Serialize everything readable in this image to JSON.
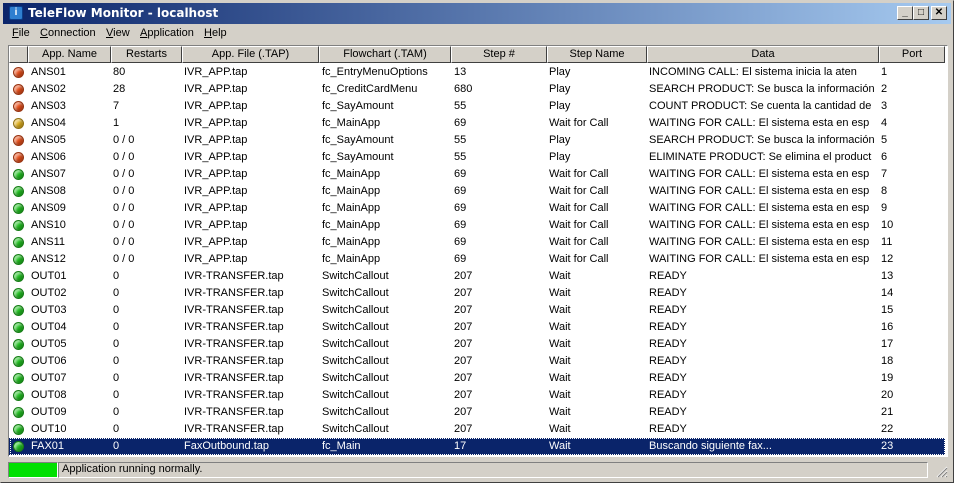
{
  "window": {
    "title": "TeleFlow Monitor - localhost",
    "icon": "info-app-icon",
    "controls": {
      "minimize": "_",
      "maximize": "□",
      "close": "✕"
    }
  },
  "menu": [
    {
      "label": "File",
      "accel": "F",
      "rest": "ile"
    },
    {
      "label": "Connection",
      "accel": "C",
      "rest": "onnection"
    },
    {
      "label": "View",
      "accel": "V",
      "rest": "iew"
    },
    {
      "label": "Application",
      "accel": "A",
      "rest": "pplication"
    },
    {
      "label": "Help",
      "accel": "H",
      "rest": "elp"
    }
  ],
  "columns": [
    "App. Name",
    "Restarts",
    "App. File (.TAP)",
    "Flowchart (.TAM)",
    "Step #",
    "Step Name",
    "Data",
    "Port"
  ],
  "status_colors": {
    "red": "#e8501c",
    "yellow": "#e0b020",
    "green": "#22c022"
  },
  "rows": [
    {
      "status": "red",
      "name": "ANS01",
      "restarts": "80",
      "file": "IVR_APP.tap",
      "flow": "fc_EntryMenuOptions",
      "step": "13",
      "stepName": "Play",
      "data": "INCOMING CALL: El sistema inicia la aten",
      "port": "1"
    },
    {
      "status": "red",
      "name": "ANS02",
      "restarts": "28",
      "file": "IVR_APP.tap",
      "flow": "fc_CreditCardMenu",
      "step": "680",
      "stepName": "Play",
      "data": "SEARCH PRODUCT: Se busca la información",
      "port": "2"
    },
    {
      "status": "red",
      "name": "ANS03",
      "restarts": "7",
      "file": "IVR_APP.tap",
      "flow": "fc_SayAmount",
      "step": "55",
      "stepName": "Play",
      "data": "COUNT PRODUCT: Se cuenta la cantidad de",
      "port": "3"
    },
    {
      "status": "yellow",
      "name": "ANS04",
      "restarts": "1",
      "file": "IVR_APP.tap",
      "flow": "fc_MainApp",
      "step": "69",
      "stepName": "Wait for Call",
      "data": "WAITING FOR CALL: El sistema esta en esp",
      "port": "4"
    },
    {
      "status": "red",
      "name": "ANS05",
      "restarts": "0 / 0",
      "file": "IVR_APP.tap",
      "flow": "fc_SayAmount",
      "step": "55",
      "stepName": "Play",
      "data": "SEARCH PRODUCT: Se busca la información",
      "port": "5"
    },
    {
      "status": "red",
      "name": "ANS06",
      "restarts": "0 / 0",
      "file": "IVR_APP.tap",
      "flow": "fc_SayAmount",
      "step": "55",
      "stepName": "Play",
      "data": "ELIMINATE PRODUCT: Se elimina el product",
      "port": "6"
    },
    {
      "status": "green",
      "name": "ANS07",
      "restarts": "0 / 0",
      "file": "IVR_APP.tap",
      "flow": "fc_MainApp",
      "step": "69",
      "stepName": "Wait for Call",
      "data": "WAITING FOR CALL: El sistema esta en esp",
      "port": "7"
    },
    {
      "status": "green",
      "name": "ANS08",
      "restarts": "0 / 0",
      "file": "IVR_APP.tap",
      "flow": "fc_MainApp",
      "step": "69",
      "stepName": "Wait for Call",
      "data": "WAITING FOR CALL: El sistema esta en esp",
      "port": "8"
    },
    {
      "status": "green",
      "name": "ANS09",
      "restarts": "0 / 0",
      "file": "IVR_APP.tap",
      "flow": "fc_MainApp",
      "step": "69",
      "stepName": "Wait for Call",
      "data": "WAITING FOR CALL: El sistema esta en esp",
      "port": "9"
    },
    {
      "status": "green",
      "name": "ANS10",
      "restarts": "0 / 0",
      "file": "IVR_APP.tap",
      "flow": "fc_MainApp",
      "step": "69",
      "stepName": "Wait for Call",
      "data": "WAITING FOR CALL: El sistema esta en esp",
      "port": "10"
    },
    {
      "status": "green",
      "name": "ANS11",
      "restarts": "0 / 0",
      "file": "IVR_APP.tap",
      "flow": "fc_MainApp",
      "step": "69",
      "stepName": "Wait for Call",
      "data": "WAITING FOR CALL: El sistema esta en esp",
      "port": "11"
    },
    {
      "status": "green",
      "name": "ANS12",
      "restarts": "0 / 0",
      "file": "IVR_APP.tap",
      "flow": "fc_MainApp",
      "step": "69",
      "stepName": "Wait for Call",
      "data": "WAITING FOR CALL: El sistema esta en esp",
      "port": "12"
    },
    {
      "status": "green",
      "name": "OUT01",
      "restarts": "0",
      "file": "IVR-TRANSFER.tap",
      "flow": "SwitchCallout",
      "step": "207",
      "stepName": "Wait",
      "data": "READY",
      "port": "13"
    },
    {
      "status": "green",
      "name": "OUT02",
      "restarts": "0",
      "file": "IVR-TRANSFER.tap",
      "flow": "SwitchCallout",
      "step": "207",
      "stepName": "Wait",
      "data": "READY",
      "port": "14"
    },
    {
      "status": "green",
      "name": "OUT03",
      "restarts": "0",
      "file": "IVR-TRANSFER.tap",
      "flow": "SwitchCallout",
      "step": "207",
      "stepName": "Wait",
      "data": "READY",
      "port": "15"
    },
    {
      "status": "green",
      "name": "OUT04",
      "restarts": "0",
      "file": "IVR-TRANSFER.tap",
      "flow": "SwitchCallout",
      "step": "207",
      "stepName": "Wait",
      "data": "READY",
      "port": "16"
    },
    {
      "status": "green",
      "name": "OUT05",
      "restarts": "0",
      "file": "IVR-TRANSFER.tap",
      "flow": "SwitchCallout",
      "step": "207",
      "stepName": "Wait",
      "data": "READY",
      "port": "17"
    },
    {
      "status": "green",
      "name": "OUT06",
      "restarts": "0",
      "file": "IVR-TRANSFER.tap",
      "flow": "SwitchCallout",
      "step": "207",
      "stepName": "Wait",
      "data": "READY",
      "port": "18"
    },
    {
      "status": "green",
      "name": "OUT07",
      "restarts": "0",
      "file": "IVR-TRANSFER.tap",
      "flow": "SwitchCallout",
      "step": "207",
      "stepName": "Wait",
      "data": "READY",
      "port": "19"
    },
    {
      "status": "green",
      "name": "OUT08",
      "restarts": "0",
      "file": "IVR-TRANSFER.tap",
      "flow": "SwitchCallout",
      "step": "207",
      "stepName": "Wait",
      "data": "READY",
      "port": "20"
    },
    {
      "status": "green",
      "name": "OUT09",
      "restarts": "0",
      "file": "IVR-TRANSFER.tap",
      "flow": "SwitchCallout",
      "step": "207",
      "stepName": "Wait",
      "data": "READY",
      "port": "21"
    },
    {
      "status": "green",
      "name": "OUT10",
      "restarts": "0",
      "file": "IVR-TRANSFER.tap",
      "flow": "SwitchCallout",
      "step": "207",
      "stepName": "Wait",
      "data": "READY",
      "port": "22"
    },
    {
      "status": "green",
      "name": "FAX01",
      "restarts": "0",
      "file": "FaxOutbound.tap",
      "flow": "fc_Main",
      "step": "17",
      "stepName": "Wait",
      "data": "Buscando siguiente fax...",
      "port": "23",
      "selected": true
    }
  ],
  "statusbar": {
    "text": "Application running normally.",
    "indicator_color": "#00e000"
  }
}
